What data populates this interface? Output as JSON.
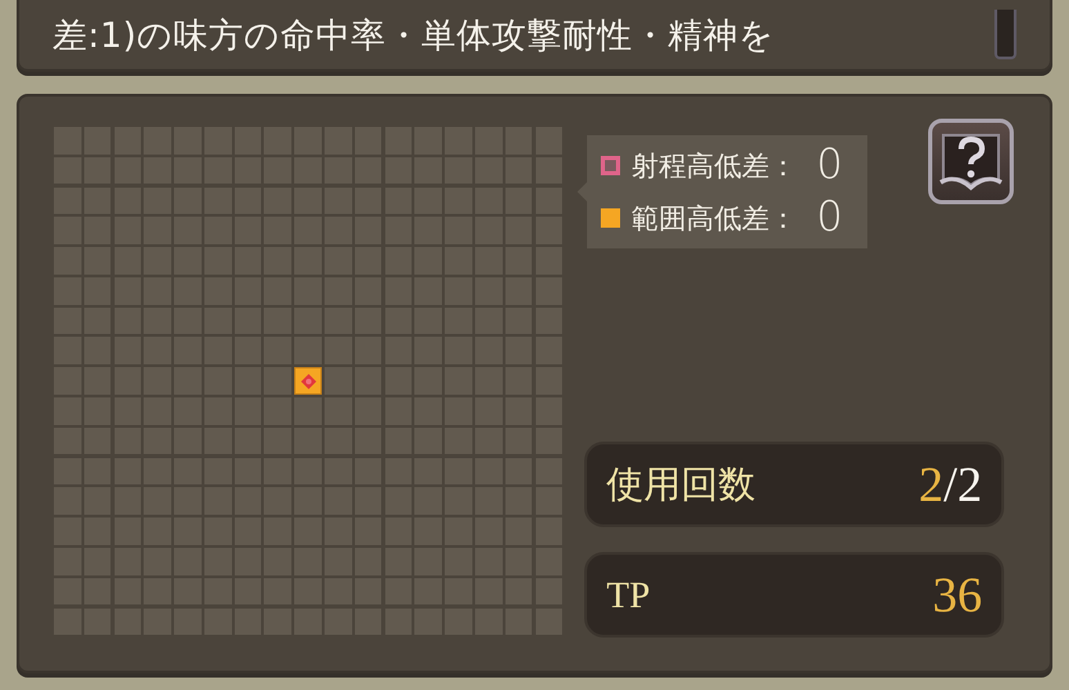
{
  "description": "差:1)の味方の命中率・単体攻撃耐性・精神を",
  "range_grid": {
    "rows": [
      [
        false,
        false,
        false,
        false,
        false,
        false,
        false,
        false,
        false,
        false,
        false,
        false,
        false,
        false,
        false,
        false,
        false
      ],
      [
        false,
        false,
        false,
        false,
        false,
        false,
        false,
        false,
        false,
        false,
        false,
        false,
        false,
        false,
        false,
        false,
        false
      ],
      [
        false,
        false,
        false,
        false,
        false,
        false,
        false,
        false,
        false,
        false,
        false,
        false,
        false,
        false,
        false,
        false,
        false
      ],
      [
        false,
        false,
        false,
        false,
        false,
        false,
        false,
        false,
        false,
        false,
        false,
        false,
        false,
        false,
        false,
        false,
        false
      ],
      [
        false,
        false,
        false,
        false,
        false,
        false,
        false,
        false,
        false,
        false,
        false,
        false,
        false,
        false,
        false,
        false,
        false
      ],
      [
        false,
        false,
        false,
        false,
        false,
        false,
        false,
        false,
        false,
        false,
        false,
        false,
        false,
        false,
        false,
        false,
        false
      ],
      [
        false,
        false,
        false,
        false,
        false,
        false,
        false,
        false,
        false,
        false,
        false,
        false,
        false,
        false,
        false,
        false,
        false
      ],
      [
        false,
        false,
        false,
        false,
        false,
        false,
        false,
        false,
        false,
        false,
        false,
        false,
        false,
        false,
        false,
        false,
        false
      ],
      [
        false,
        false,
        false,
        false,
        false,
        false,
        false,
        false,
        true,
        false,
        false,
        false,
        false,
        false,
        false,
        false,
        false
      ],
      [
        false,
        false,
        false,
        false,
        false,
        false,
        false,
        false,
        false,
        false,
        false,
        false,
        false,
        false,
        false,
        false,
        false
      ],
      [
        false,
        false,
        false,
        false,
        false,
        false,
        false,
        false,
        false,
        false,
        false,
        false,
        false,
        false,
        false,
        false,
        false
      ],
      [
        false,
        false,
        false,
        false,
        false,
        false,
        false,
        false,
        false,
        false,
        false,
        false,
        false,
        false,
        false,
        false,
        false
      ],
      [
        false,
        false,
        false,
        false,
        false,
        false,
        false,
        false,
        false,
        false,
        false,
        false,
        false,
        false,
        false,
        false,
        false
      ],
      [
        false,
        false,
        false,
        false,
        false,
        false,
        false,
        false,
        false,
        false,
        false,
        false,
        false,
        false,
        false,
        false,
        false
      ],
      [
        false,
        false,
        false,
        false,
        false,
        false,
        false,
        false,
        false,
        false,
        false,
        false,
        false,
        false,
        false,
        false,
        false
      ],
      [
        false,
        false,
        false,
        false,
        false,
        false,
        false,
        false,
        false,
        false,
        false,
        false,
        false,
        false,
        false,
        false,
        false
      ],
      [
        false,
        false,
        false,
        false,
        false,
        false,
        false,
        false,
        false,
        false,
        false,
        false,
        false,
        false,
        false,
        false,
        false
      ]
    ]
  },
  "legend": [
    {
      "kind": "outline",
      "color": "#e0648a",
      "label": "射程高低差：",
      "value": "0"
    },
    {
      "kind": "filled",
      "color": "#f5a623",
      "label": "範囲高低差：",
      "value": "0"
    }
  ],
  "stats": [
    {
      "label": "使用回数",
      "value": "2",
      "suffix": "/2"
    },
    {
      "label": "TP",
      "value": "36"
    }
  ]
}
